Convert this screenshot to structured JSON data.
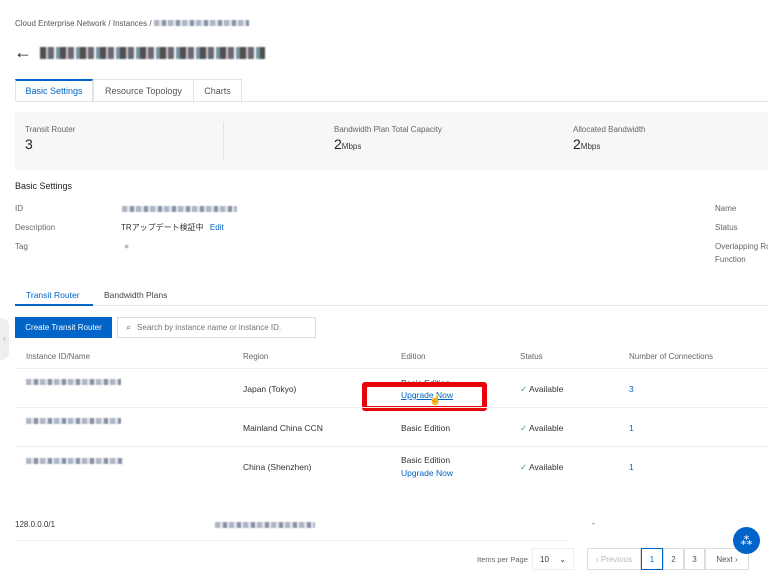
{
  "breadcrumb": {
    "items": [
      "Cloud Enterprise Network",
      "Instances"
    ],
    "sep": "/"
  },
  "tabs": [
    "Basic Settings",
    "Resource Topology",
    "Charts"
  ],
  "summary": [
    {
      "label": "Transit Router",
      "value": "3",
      "unit": ""
    },
    {
      "label": "Bandwidth Plan Total Capacity",
      "value": "2",
      "unit": "Mbps"
    },
    {
      "label": "Allocated Bandwidth",
      "value": "2",
      "unit": "Mbps"
    }
  ],
  "basic": {
    "title": "Basic Settings",
    "id_label": "ID",
    "desc_label": "Description",
    "desc_value": "TRアップデート検証中",
    "edit": "Edit",
    "tag_label": "Tag",
    "name_label": "Name",
    "status_label": "Status",
    "overlap_label": "Overlapping Ro",
    "function_label": "Function"
  },
  "subtabs": [
    "Transit Router",
    "Bandwidth Plans"
  ],
  "toolbar": {
    "create": "Create Transit Router",
    "search_placeholder": "Search by instance name or instance ID."
  },
  "table": {
    "headers": [
      "Instance ID/Name",
      "Region",
      "Edition",
      "Status",
      "Number of Connections"
    ],
    "rows": [
      {
        "region": "Japan (Tokyo)",
        "edition": "Basic Edition",
        "upgrade": "Upgrade Now",
        "status": "Available",
        "connections": "3"
      },
      {
        "region": "Mainland China CCN",
        "edition": "Basic Edition",
        "upgrade": "",
        "status": "Available",
        "connections": "1"
      },
      {
        "region": "China (Shenzhen)",
        "edition": "Basic Edition",
        "upgrade": "Upgrade Now",
        "status": "Available",
        "connections": "1"
      }
    ]
  },
  "footer_row": {
    "cidr": "128.0.0.0/1",
    "dash": "-"
  },
  "pagination": {
    "items_label": "Items per Page",
    "per_page": "10",
    "prev": "Previous",
    "pages": [
      "1",
      "2",
      "3"
    ],
    "next": "Next"
  },
  "colors": {
    "accent": "#0064c8",
    "highlight": "#e8000b",
    "success": "#3aa655"
  }
}
